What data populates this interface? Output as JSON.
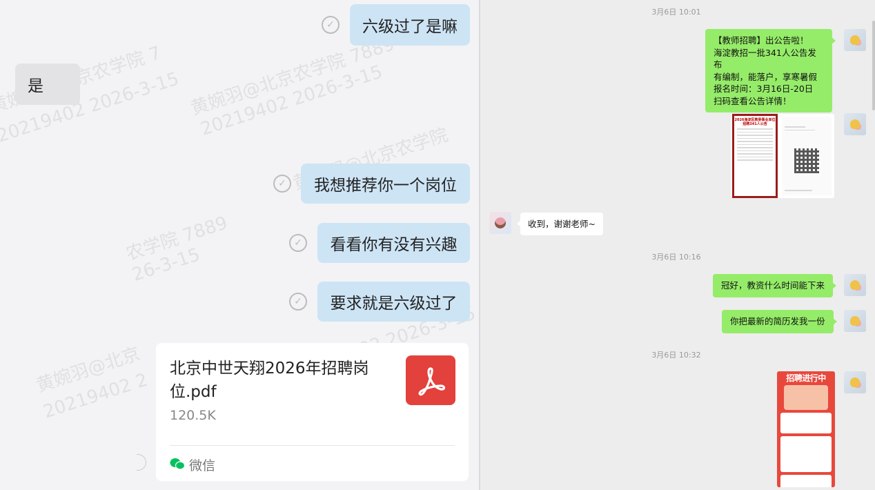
{
  "left": {
    "watermarks": [
      "黄婉羽@北京农学院 7889",
      "20219402 2026-3-15",
      "农学院 7889",
      "26-3-15",
      "黄婉羽@北京农学院",
      "20219402 2026-3-15",
      "黄婉羽@北京农学院 7",
      "20219402 2026-3-15",
      "黄婉羽@北京",
      "20219402 2"
    ],
    "messages": {
      "sent_1": "六级过了是嘛",
      "received_1": "是",
      "sent_2": "我想推荐你一个岗位",
      "sent_3": "看看你有没有兴趣",
      "sent_4": "要求就是六级过了"
    },
    "file": {
      "name": "北京中世天翔2026年招聘岗位.pdf",
      "size": "120.5K",
      "source": "微信"
    }
  },
  "right": {
    "timestamps": [
      "3月6日 10:01",
      "3月6日 10:16",
      "3月6日 10:32"
    ],
    "announcement": {
      "lines": [
        "【教师招聘】出公告啦！",
        "海淀教招一批341人公告发布",
        "有编制，能落户，享寒暑假",
        "报名时间：3月16日-20日",
        "扫码查看公告详情！"
      ]
    },
    "poster_title": "2026海淀区教委事业单位招聘341人公告",
    "reply": "收到，谢谢老师~",
    "msg_1016_a": "冠好，教资什么时间能下来",
    "msg_1016_b": "你把最新的简历发我一份",
    "recruit_image_title": "招聘进行中"
  },
  "colors": {
    "sent_bubble_left": "#cde4f5",
    "sent_bubble_right": "#95ec69",
    "pdf_red": "#e2413c",
    "wechat_green": "#07c160"
  }
}
